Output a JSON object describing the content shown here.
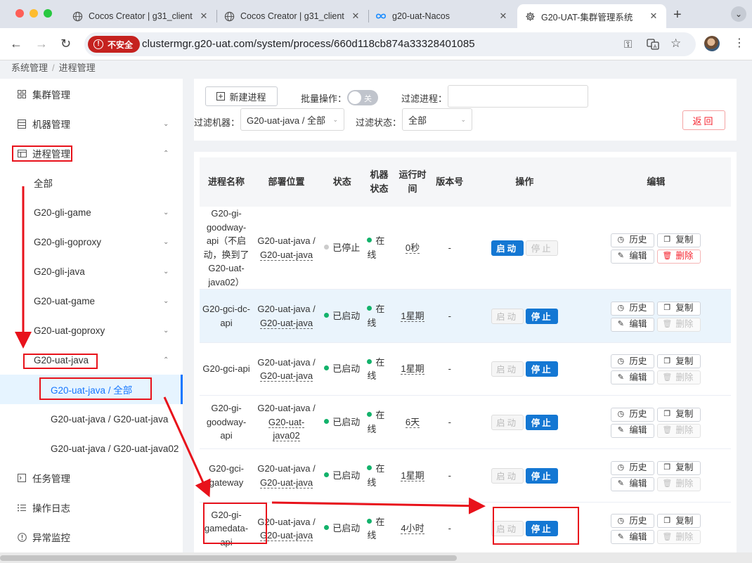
{
  "browser": {
    "tabs": [
      {
        "label": "Cocos Creator | g31_client",
        "icon": "globe-icon",
        "active": false
      },
      {
        "label": "Cocos Creator | g31_client",
        "icon": "globe-icon",
        "active": false
      },
      {
        "label": "g20-uat-Nacos",
        "icon": "nacos-icon",
        "active": false
      },
      {
        "label": "G20-UAT-集群管理系统",
        "icon": "gear-icon",
        "active": true
      }
    ],
    "insecure_label": "不安全",
    "url": "clustermgr.g20-uat.com/system/process/660d118cb874a33328401085"
  },
  "breadcrumb": [
    "系统管理",
    "进程管理"
  ],
  "sidebar": {
    "items": [
      {
        "label": "集群管理",
        "icon": "grid-icon"
      },
      {
        "label": "机器管理",
        "icon": "server-icon"
      },
      {
        "label": "进程管理",
        "icon": "table-icon"
      },
      {
        "label": "全部"
      },
      {
        "label": "G20-gli-game"
      },
      {
        "label": "G20-gli-goproxy"
      },
      {
        "label": "G20-gli-java"
      },
      {
        "label": "G20-uat-game"
      },
      {
        "label": "G20-uat-goproxy"
      },
      {
        "label": "G20-uat-java"
      },
      {
        "label": "G20-uat-java / 全部"
      },
      {
        "label": "G20-uat-java / G20-uat-java"
      },
      {
        "label": "G20-uat-java / G20-uat-java02"
      },
      {
        "label": "任务管理",
        "icon": "terminal-icon"
      },
      {
        "label": "操作日志",
        "icon": "list-icon"
      },
      {
        "label": "异常监控",
        "icon": "alert-icon"
      }
    ]
  },
  "filters": {
    "new_process": "新建进程",
    "batch_label": "批量操作：",
    "batch_switch": "关",
    "filter_process_label": "过滤进程：",
    "filter_process_value": "",
    "filter_machine_label": "过滤机器：",
    "filter_machine_value": "G20-uat-java / 全部",
    "filter_status_label": "过滤状态：",
    "filter_status_value": "全部",
    "return_label": "返回"
  },
  "table": {
    "headers": [
      "进程名称",
      "部署位置",
      "状态",
      "机器状态",
      "运行时间",
      "版本号",
      "操作",
      "编辑"
    ],
    "start_label": "启动",
    "stop_label": "停止",
    "edit_buttons": {
      "history": "历史",
      "copy": "复制",
      "edit": "编辑",
      "delete": "删除"
    },
    "rows": [
      {
        "name": "G20-gi-goodway-api（不启动，换到了G20-uat-java02）",
        "loc_prefix": "G20-uat-java / ",
        "loc_link": "G20-uat-java",
        "status": "已停止",
        "status_color": "#cccccc",
        "machine": "在线",
        "runtime": "0秒",
        "version": "-",
        "running": false
      },
      {
        "name": "G20-gci-dc-api",
        "loc_prefix": "G20-uat-java / ",
        "loc_link": "G20-uat-java",
        "status": "已启动",
        "status_color": "#13b26b",
        "machine": "在线",
        "runtime": "1星期",
        "version": "-",
        "running": true
      },
      {
        "name": "G20-gci-api",
        "loc_prefix": "G20-uat-java / ",
        "loc_link": "G20-uat-java",
        "status": "已启动",
        "status_color": "#13b26b",
        "machine": "在线",
        "runtime": "1星期",
        "version": "-",
        "running": true
      },
      {
        "name": "G20-gi-goodway-api",
        "loc_prefix": "G20-uat-java / ",
        "loc_link": "G20-uat-java02",
        "status": "已启动",
        "status_color": "#13b26b",
        "machine": "在线",
        "runtime": "6天",
        "version": "-",
        "running": true
      },
      {
        "name": "G20-gci-gateway",
        "loc_prefix": "G20-uat-java / ",
        "loc_link": "G20-uat-java",
        "status": "已启动",
        "status_color": "#13b26b",
        "machine": "在线",
        "runtime": "1星期",
        "version": "-",
        "running": true
      },
      {
        "name": "G20-gi-gamedata-api",
        "loc_prefix": "G20-uat-java / ",
        "loc_link": "G20-uat-java",
        "status": "已启动",
        "status_color": "#13b26b",
        "machine": "在线",
        "runtime": "4小时",
        "version": "-",
        "running": true
      }
    ]
  },
  "colors": {
    "accent": "#1677ff",
    "primary_button": "#1477d3",
    "danger": "#f5222d",
    "annotation": "#e8121b",
    "online_dot": "#13b26b"
  }
}
